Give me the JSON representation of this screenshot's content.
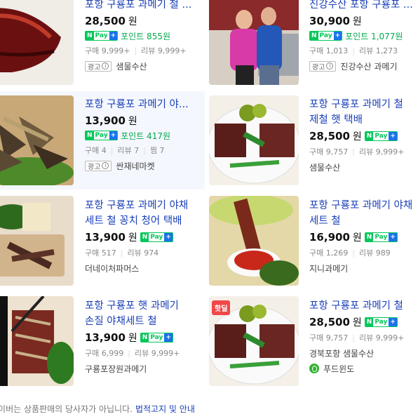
{
  "products": [
    {
      "title": "포항 구룡포 과메기 철 ...",
      "price": "28,500",
      "unit": "원",
      "npay": true,
      "points": "포인트 855원",
      "stats": [
        "구매 9,999+",
        "리뷰 9,999+"
      ],
      "ad_label": "광고",
      "seller": "샘물수산"
    },
    {
      "title": "진강수산 포항 구룡포 ...",
      "price": "30,900",
      "unit": "원",
      "npay": true,
      "points": "포인트 1,077원",
      "stats": [
        "구매 1,013",
        "리뷰 1,273"
      ],
      "ad_label": "광고",
      "seller": "진강수산 과메기"
    },
    {
      "title": "포항 구룡포 과메기 야...",
      "price": "13,900",
      "unit": "원",
      "npay": true,
      "points": "포인트 417원",
      "stats": [
        "구매 4",
        "리뷰 7",
        "찜 7"
      ],
      "ad_label": "광고",
      "seller": "싼재네마켓"
    },
    {
      "title_lines": [
        "포항 구룡포 과메기 철",
        "제철 햇 택배"
      ],
      "price": "28,500",
      "unit": "원",
      "npay": true,
      "stats": [
        "구매 9,757",
        "리뷰 9,999+"
      ],
      "seller": "샘물수산"
    },
    {
      "title_lines": [
        "포항 구룡포 과메기 야채",
        "세트 철 꽁치 청어 택배"
      ],
      "price": "13,900",
      "unit": "원",
      "npay": true,
      "stats": [
        "구매 517",
        "리뷰 974"
      ],
      "seller": "더네이처파머스"
    },
    {
      "title_lines": [
        "포항 구룡포 과메기 야채",
        "세트 철"
      ],
      "price": "16,900",
      "unit": "원",
      "npay": true,
      "stats": [
        "구매 1,269",
        "리뷰 989"
      ],
      "seller": "지니과메기"
    },
    {
      "title_lines": [
        "포항 구룡포 햇 과메기",
        "손질 야채세트 철"
      ],
      "price": "13,900",
      "unit": "원",
      "npay": true,
      "stats": [
        "구매 6,999",
        "리뷰 9,999+"
      ],
      "seller": "구룡포장원과메기"
    },
    {
      "title_lines": [
        "포항 구룡포 과메기 철"
      ],
      "price": "28,500",
      "unit": "원",
      "npay": true,
      "stats": [
        "구매 9,757",
        "리뷰 9,999+"
      ],
      "seller": "경북포항 샘물수산",
      "badge": "핫딜",
      "extra": "푸드윈도"
    }
  ],
  "npay": {
    "n": "N",
    "pay": "Pay",
    "plus": "+"
  },
  "footer": {
    "text": "네이버는 상품판매의 당사자가 아닙니다.",
    "link": "법적고지 및 안내"
  }
}
